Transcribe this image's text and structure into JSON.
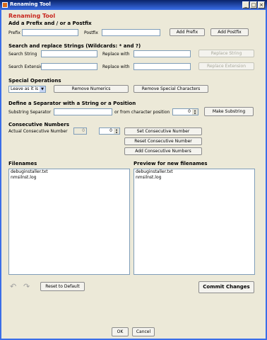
{
  "window": {
    "title": "Renaming Tool",
    "min": "_",
    "max": "□",
    "close": "×"
  },
  "app_title": "Renaming Tool",
  "prefix": {
    "heading": "Add a Prefix and / or a Postfix",
    "prefix_label": "Prefix",
    "prefix_value": "",
    "postfix_label": "Postfix",
    "postfix_value": "",
    "add_prefix": "Add Prefix",
    "add_postfix": "Add Postfix"
  },
  "search": {
    "heading": "Search and replace Strings (Wildcards: * and ?)",
    "search_string_label": "Search String",
    "search_string_value": "",
    "replace_with_label": "Replace with",
    "replace_with_value": "",
    "replace_string_btn": "Replace String",
    "search_ext_label": "Search Extension",
    "search_ext_value": "",
    "replace_with_ext_label": "Replace with",
    "replace_with_ext_value": "",
    "replace_ext_btn": "Replace Extension"
  },
  "special": {
    "heading": "Special Operations",
    "combo_value": "Leave as it is",
    "remove_numerics": "Remove Numerics",
    "remove_special": "Remove Special Characters"
  },
  "separator": {
    "heading": "Define a Separator with a String or a Position",
    "substring_label": "Substring Separator",
    "substring_value": "",
    "or_from_label": "or from character position",
    "position_value": "0",
    "make_substring": "Make Substring"
  },
  "consecutive": {
    "heading": "Consecutive Numbers",
    "actual_label": "Actual Consecutive Number",
    "actual_value": "0",
    "spin_value": "0",
    "set_btn": "Set Consecutive Number",
    "reset_btn": "Reset Consecutive Number",
    "add_btn": "Add Consecutive Numbers"
  },
  "filenames": {
    "heading": "Filenames",
    "items": [
      "debuginstaller.txt",
      "nmsilnst.log"
    ]
  },
  "preview": {
    "heading": "Preview for new filenames",
    "items": [
      "debuginstaller.txt",
      "nmsilnst.log"
    ]
  },
  "bottom": {
    "undo": "↶",
    "redo": "↷",
    "reset_default": "Reset to Default",
    "commit": "Commit Changes",
    "ok": "OK",
    "cancel": "Cancel"
  },
  "colors": {
    "heading_red": "#c8261e",
    "titlebar": "#0a246a",
    "window_bg": "#ece9d8"
  }
}
